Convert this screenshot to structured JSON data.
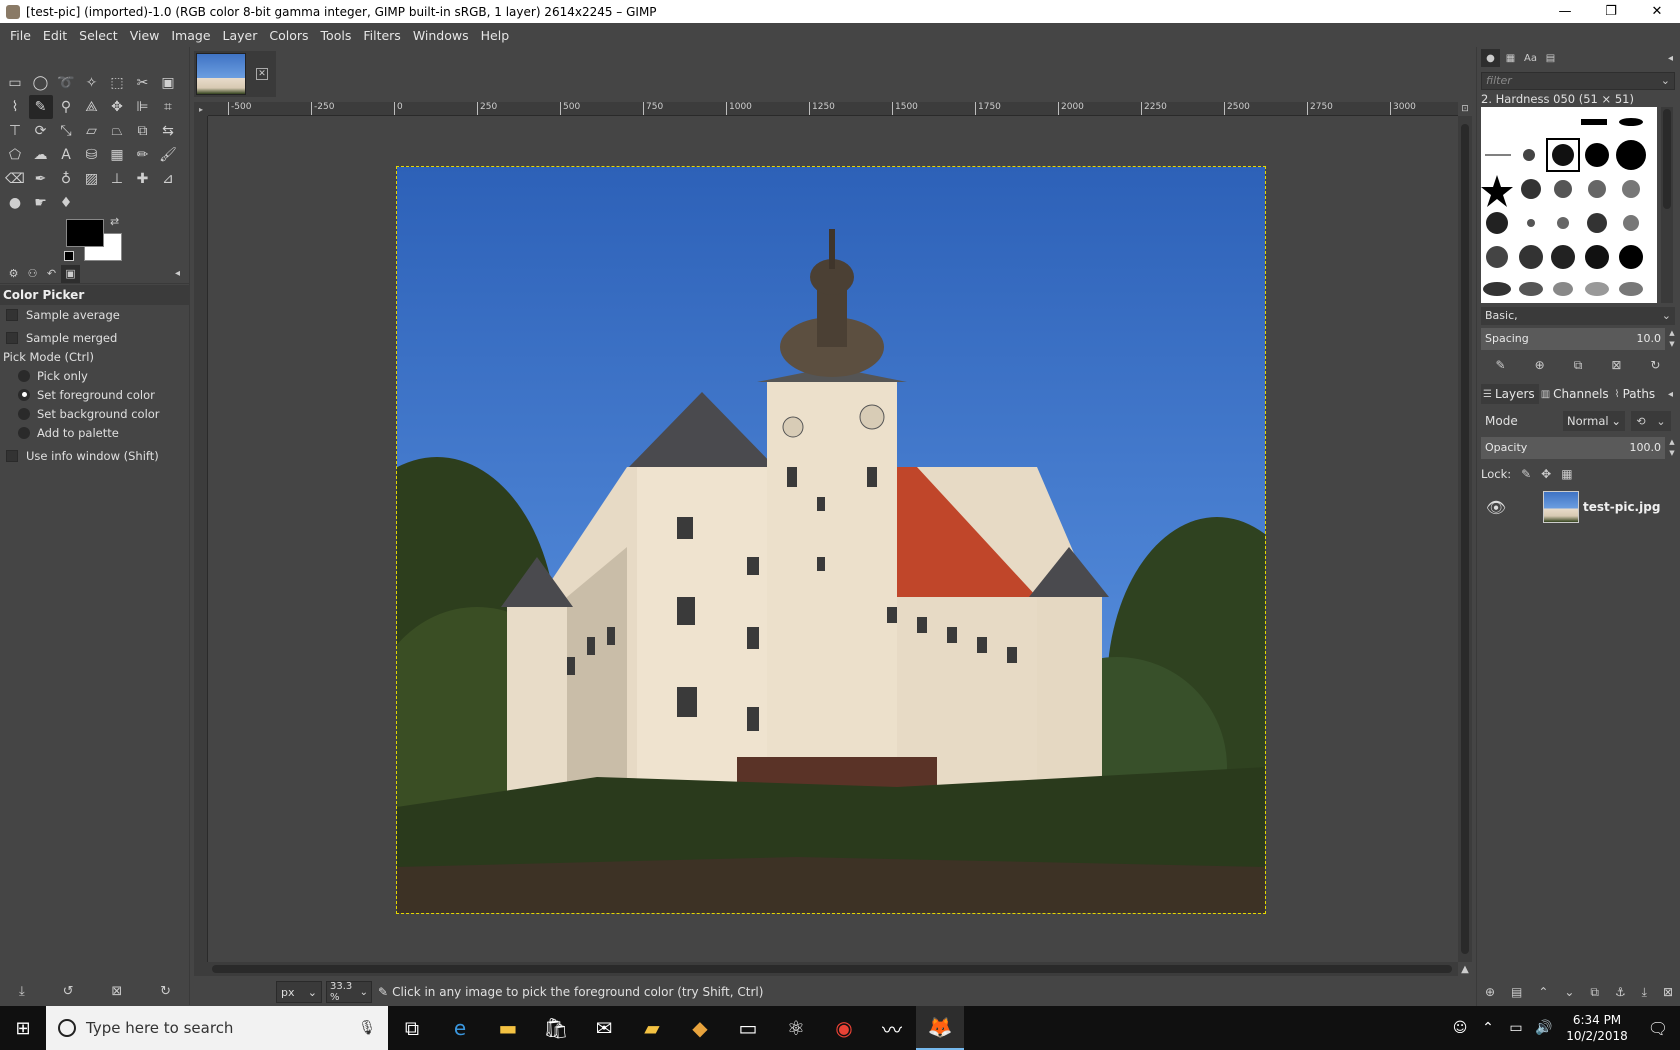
{
  "window": {
    "title": "[test-pic] (imported)-1.0 (RGB color 8-bit gamma integer, GIMP built-in sRGB, 1 layer) 2614x2245 – GIMP",
    "minimize": "—",
    "maximize": "❐",
    "close": "✕"
  },
  "menu": [
    "File",
    "Edit",
    "Select",
    "View",
    "Image",
    "Layer",
    "Colors",
    "Tools",
    "Filters",
    "Windows",
    "Help"
  ],
  "tool_options": {
    "title": "Color Picker",
    "sample_average": "Sample average",
    "sample_merged": "Sample merged",
    "pick_mode_label": "Pick Mode  (Ctrl)",
    "pick_only": "Pick only",
    "set_foreground": "Set foreground color",
    "set_background": "Set background color",
    "add_to_palette": "Add to palette",
    "selected_mode": "set_foreground",
    "use_info_window": "Use info window  (Shift)"
  },
  "colors": {
    "foreground": "#000000",
    "background": "#ffffff",
    "selection_outline": "#e5d800"
  },
  "rulers": {
    "horizontal": [
      "-500",
      "-250",
      "0",
      "250",
      "500",
      "750",
      "1000",
      "1250",
      "1500",
      "1750",
      "2000",
      "2250",
      "2500",
      "2750",
      "3000"
    ]
  },
  "statusbar": {
    "unit": "px",
    "zoom": "33.3 %",
    "message": "Click in any image to pick the foreground color (try Shift, Ctrl)"
  },
  "brushes": {
    "filter_placeholder": "filter",
    "current": "2. Hardness 050 (51 × 51)",
    "set": "Basic,",
    "spacing_label": "Spacing",
    "spacing_value": "10.0"
  },
  "layers": {
    "tabs": [
      "Layers",
      "Channels",
      "Paths"
    ],
    "mode_label": "Mode",
    "mode_value": "Normal",
    "opacity_label": "Opacity",
    "opacity_value": "100.0",
    "lock_label": "Lock:",
    "items": [
      {
        "name": "test-pic.jpg"
      }
    ]
  },
  "taskbar": {
    "search_placeholder": "Type here to search",
    "time": "6:34 PM",
    "date": "10/2/2018"
  }
}
